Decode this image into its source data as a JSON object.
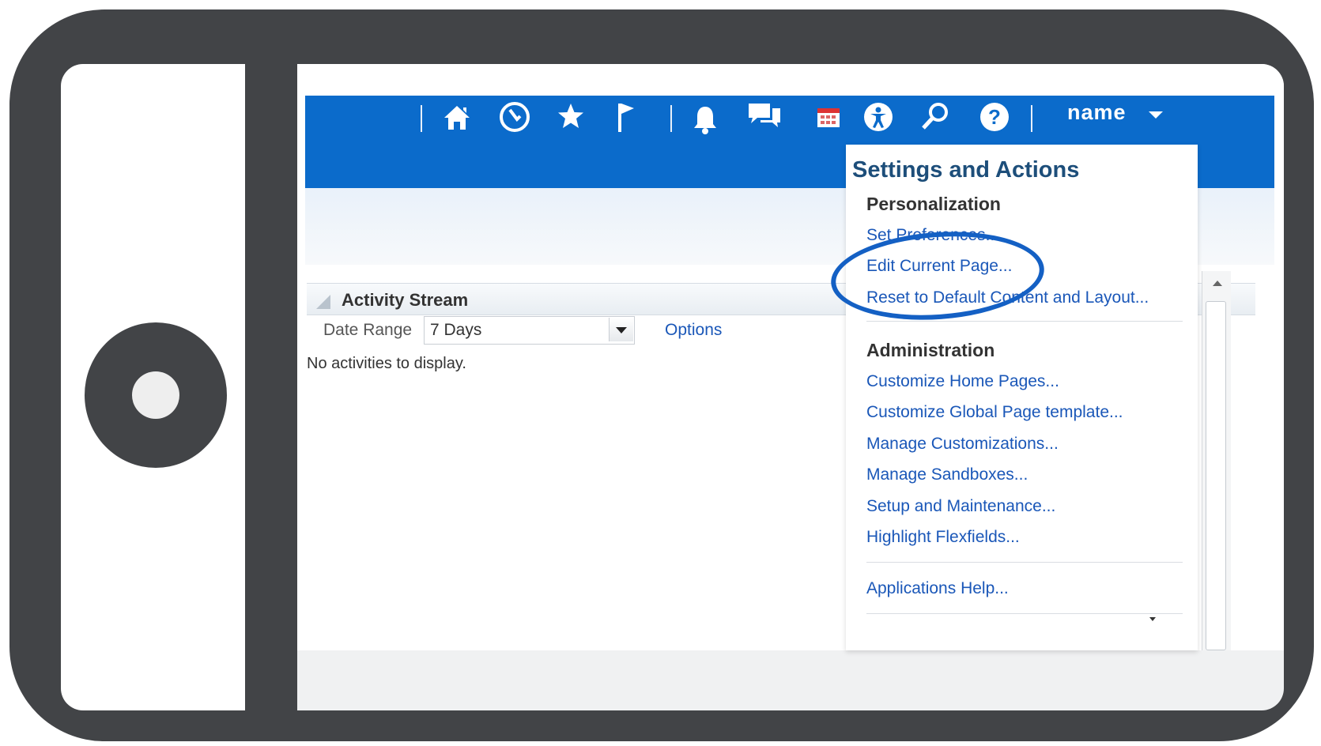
{
  "topbar": {
    "icons": [
      "home-icon",
      "recent-icon",
      "favorites-icon",
      "watchlist-icon",
      "notifications-icon",
      "messages-icon",
      "calendar-icon",
      "accessibility-icon",
      "search-icon",
      "help-icon"
    ],
    "user_name": "name"
  },
  "activity_stream": {
    "title": "Activity Stream",
    "date_range_label": "Date Range",
    "date_range_value": "7 Days",
    "options_label": "Options",
    "empty_message": "No activities to display."
  },
  "menu": {
    "title": "Settings and Actions",
    "personalization": {
      "heading": "Personalization",
      "items": [
        "Set Preferences...",
        "Edit Current Page...",
        "Reset to Default Content and Layout..."
      ]
    },
    "administration": {
      "heading": "Administration",
      "items": [
        "Customize Home Pages...",
        "Customize Global Page template...",
        "Manage Customizations...",
        "Manage Sandboxes...",
        "Setup and Maintenance...",
        "Highlight Flexfields..."
      ]
    },
    "help_item": "Applications Help..."
  },
  "colors": {
    "brand_blue": "#0b6bcb",
    "link_blue": "#1a57b8",
    "frame_gray": "#424447",
    "highlight_blue": "#1460c4"
  }
}
